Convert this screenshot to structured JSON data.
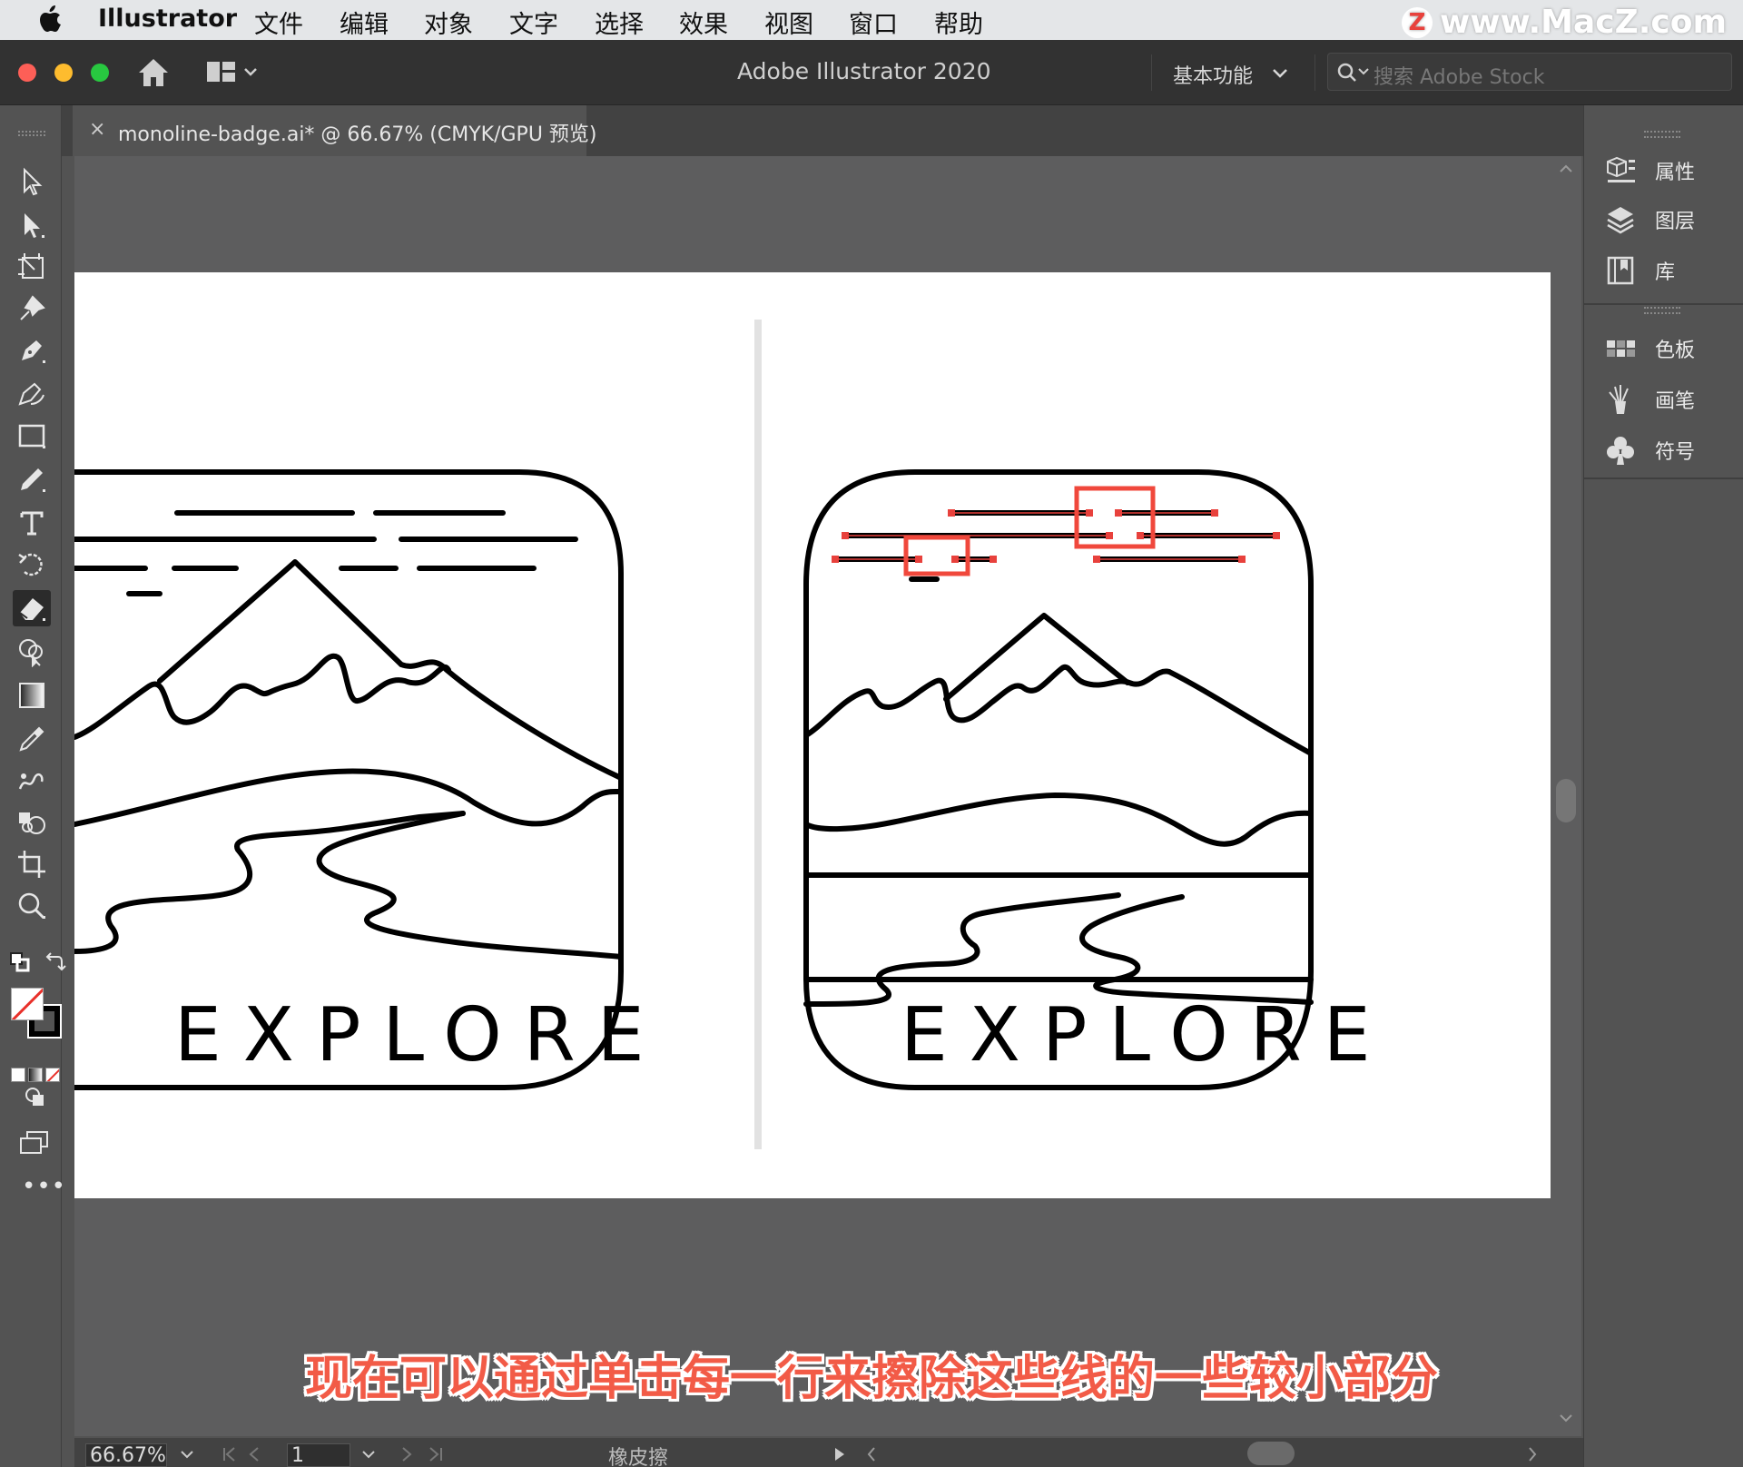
{
  "menubar": {
    "app_name": "Illustrator",
    "items": [
      "文件",
      "编辑",
      "对象",
      "文字",
      "选择",
      "效果",
      "视图",
      "窗口",
      "帮助"
    ],
    "watermark_text": "www.MacZ.com",
    "watermark_logo": "Z"
  },
  "titlebar": {
    "title": "Adobe Illustrator 2020",
    "workspace": "基本功能",
    "search_placeholder": "搜索 Adobe Stock"
  },
  "document_tab": {
    "close": "×",
    "label": "monoline-badge.ai* @ 66.67% (CMYK/GPU 预览)"
  },
  "toolbar": {
    "tools": [
      "selection-tool",
      "direct-selection-tool",
      "artboard-tool",
      "pin-tool",
      "pen-tool",
      "curvature-tool",
      "rectangle-tool",
      "pencil-tool",
      "type-tool",
      "rotate-tool",
      "eraser-tool",
      "shape-builder-tool",
      "gradient-tool",
      "eyedropper-tool",
      "blend-tool",
      "symbol-sprayer-tool",
      "crop-tool",
      "zoom-tool"
    ],
    "active_tool": "eraser-tool",
    "more": "•••"
  },
  "right_panel": {
    "group1": [
      {
        "label": "属性",
        "icon": "properties-icon"
      },
      {
        "label": "图层",
        "icon": "layers-icon"
      },
      {
        "label": "库",
        "icon": "libraries-icon"
      }
    ],
    "group2": [
      {
        "label": "色板",
        "icon": "swatches-icon"
      },
      {
        "label": "画笔",
        "icon": "brushes-icon"
      },
      {
        "label": "符号",
        "icon": "symbols-icon"
      }
    ]
  },
  "artwork": {
    "left_badge_text": "EXPLORE",
    "right_badge_text": "EXPLORE"
  },
  "statusbar": {
    "zoom": "66.67%",
    "page": "1",
    "tool_name": "橡皮擦"
  },
  "caption": "现在可以通过单击每一行来擦除这些线的一些较小部分",
  "colors": {
    "highlight_box": "#f0483c",
    "anchor_point": "#e8413c",
    "caption": "#f25b47"
  }
}
